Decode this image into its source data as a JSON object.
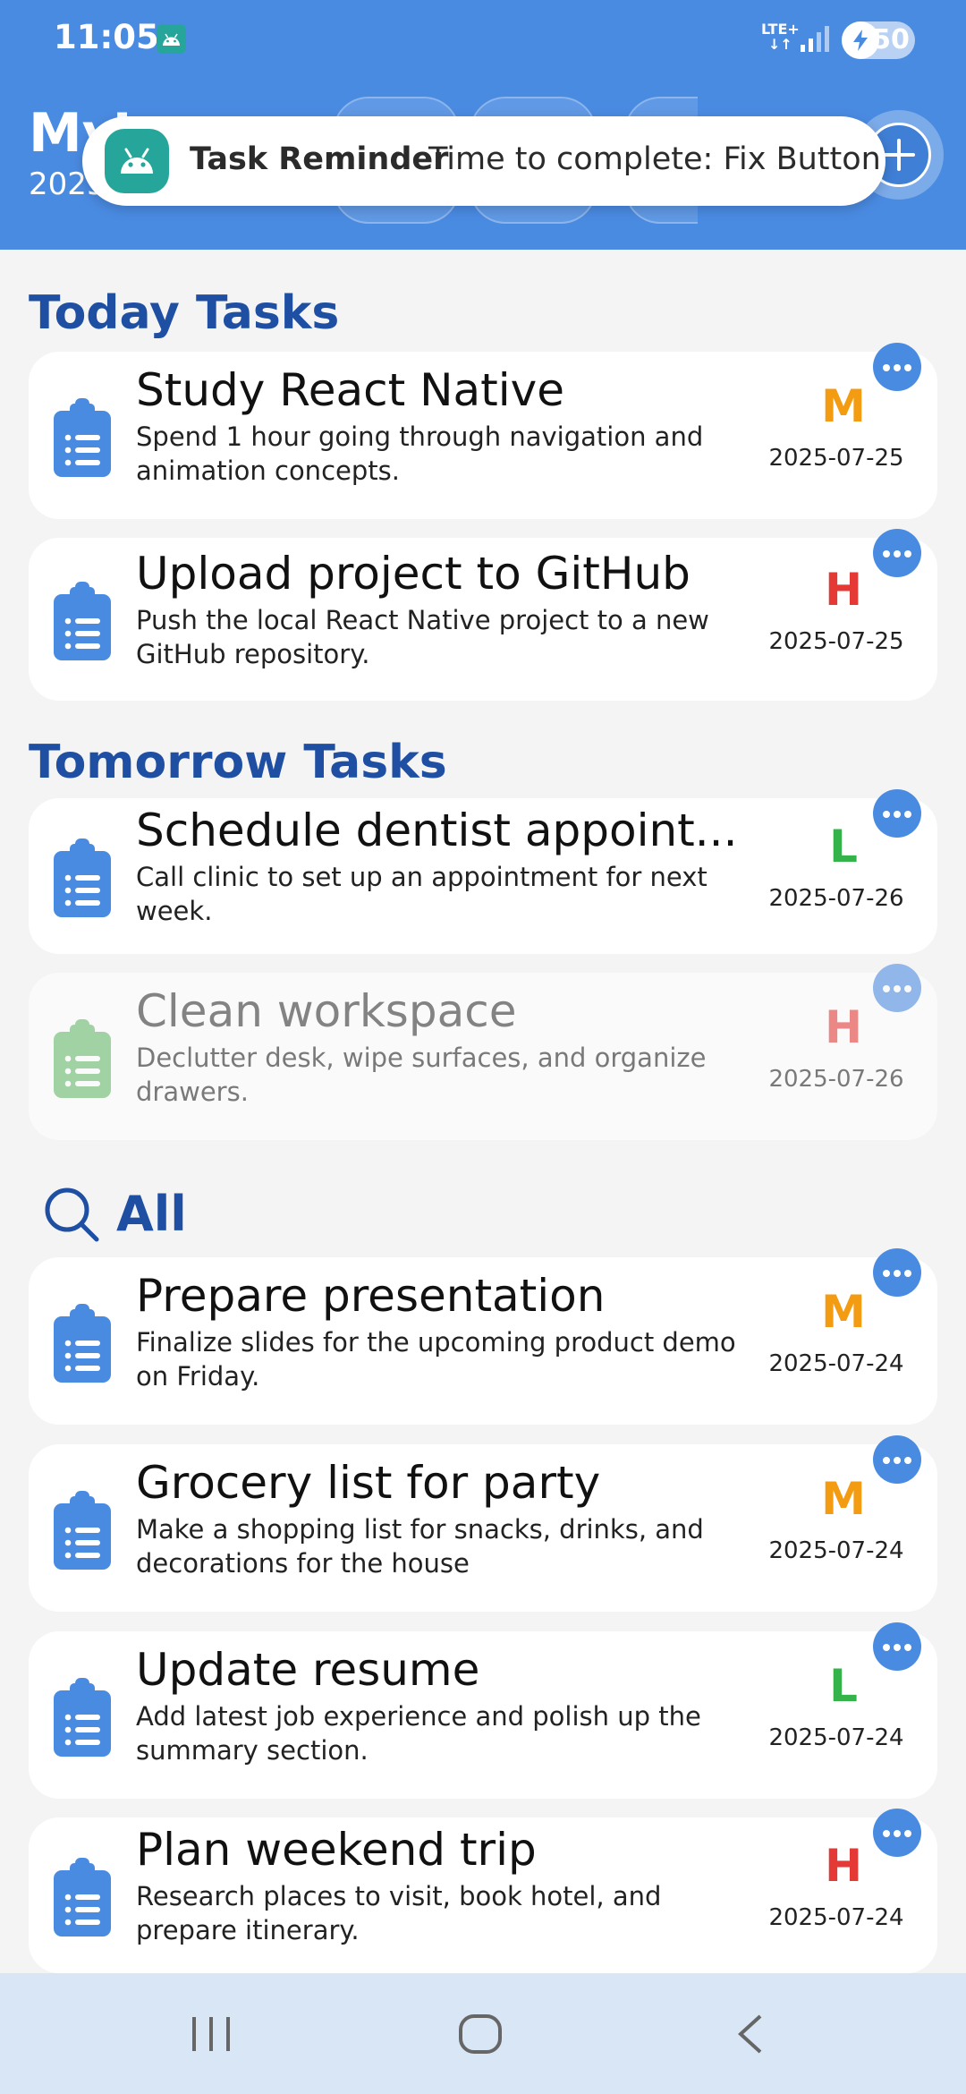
{
  "status_bar": {
    "time": "11:05",
    "network": "LTE+",
    "network_arrows": "↓↑",
    "battery": "50"
  },
  "header": {
    "app_title": "MyTasks",
    "date": "2025-07-25"
  },
  "notification": {
    "title": "Task Reminder",
    "message": "Time to complete: Fix Button"
  },
  "sections": {
    "today": "Today Tasks",
    "tomorrow": "Tomorrow Tasks",
    "all": "All"
  },
  "colors": {
    "primary": "#4a8be2",
    "section_title": "#1f4fa3",
    "priority_H": "#e53935",
    "priority_M": "#f39c12",
    "priority_L": "#34b34a",
    "clipboard_default": "#4a8be2",
    "clipboard_done": "#66bb6a"
  },
  "today_tasks": [
    {
      "title": "Study React Native",
      "description": "Spend 1 hour going through navigation and animation concepts.",
      "priority": "M",
      "date": "2025-07-25"
    },
    {
      "title": "Upload project to GitHub",
      "description": "Push the local React Native project to a new GitHub repository.",
      "priority": "H",
      "date": "2025-07-25"
    }
  ],
  "tomorrow_tasks": [
    {
      "title": "Schedule dentist appoint...",
      "description": "Call clinic to set up an appointment for next week.",
      "priority": "L",
      "date": "2025-07-26"
    },
    {
      "title": "Clean workspace",
      "description": "Declutter desk, wipe surfaces, and organize drawers.",
      "priority": "H",
      "date": "2025-07-26",
      "completed": true
    }
  ],
  "all_tasks": [
    {
      "title": "Prepare presentation",
      "description": "Finalize slides for the upcoming product demo on Friday.",
      "priority": "M",
      "date": "2025-07-24"
    },
    {
      "title": "Grocery list for party",
      "description": "Make a shopping list for snacks, drinks, and decorations for the house",
      "priority": "M",
      "date": "2025-07-24"
    },
    {
      "title": "Update resume",
      "description": "Add latest job experience and polish up the summary section.",
      "priority": "L",
      "date": "2025-07-24"
    },
    {
      "title": "Plan weekend trip",
      "description": "Research places to visit, book hotel, and prepare itinerary.",
      "priority": "H",
      "date": "2025-07-24"
    }
  ],
  "icons": {
    "task": "clipboard-list-icon",
    "more": "more-horizontal-icon",
    "add": "plus-circle-icon",
    "search": "search-icon",
    "nav": [
      "recent-apps-icon",
      "home-icon",
      "back-icon"
    ]
  }
}
